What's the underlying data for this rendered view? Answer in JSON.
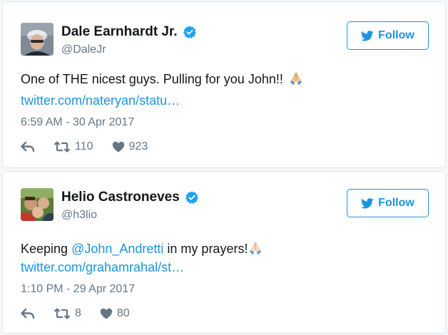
{
  "colors": {
    "link": "#1b95e0",
    "text": "#14171a",
    "muted": "#657786",
    "border": "#e1e8ed",
    "verified": "#1da1f2"
  },
  "icons": {
    "verified": "verified-badge-icon",
    "follow": "twitter-bird-icon",
    "reply": "reply-icon",
    "retweet": "retweet-icon",
    "like": "heart-icon",
    "emoji": "folded-hands-emoji"
  },
  "tweets": [
    {
      "display_name": "Dale Earnhardt Jr.",
      "handle": "@DaleJr",
      "follow_label": "Follow",
      "text_before": "One of THE nicest guys. Pulling for you John!!",
      "mention": "",
      "text_after": "",
      "link": "twitter.com/nateryan/statu…",
      "timestamp": "6:59 AM - 30 Apr 2017",
      "retweets": "110",
      "likes": "923"
    },
    {
      "display_name": "Helio Castroneves",
      "handle": "@h3lio",
      "follow_label": "Follow",
      "text_before": "Keeping ",
      "mention": "@John_Andretti",
      "text_after": " in my prayers!",
      "link": "twitter.com/grahamrahal/st…",
      "timestamp": "1:10 PM - 29 Apr 2017",
      "retweets": "8",
      "likes": "80"
    }
  ]
}
